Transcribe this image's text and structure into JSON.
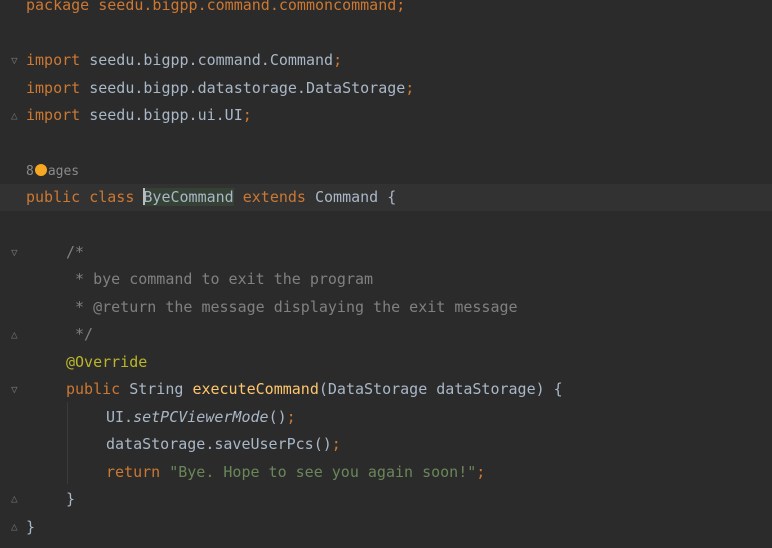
{
  "code": {
    "line_package": "package seedu.bigpp.command.commoncommand;",
    "import1_kw": "import",
    "import1_path": " seedu.bigpp.command.Command",
    "import2_kw": "import",
    "import2_path": " seedu.bigpp.datastorage.DataStorage",
    "import3_kw": "import",
    "import3_path": " seedu.bigpp.ui.UI",
    "semicolon": ";",
    "usages_prefix": "8",
    "usages_suffix": "ages",
    "class_kw": "public class ",
    "class_name": "ByeCommand",
    "extends_kw": " extends ",
    "extends_rest": "Command {",
    "cmt1": "/*",
    "cmt2": " * bye command to exit the program",
    "cmt3": " * @return the message displaying the exit message",
    "cmt4": " */",
    "annotation": "@Override",
    "method_kw": "public",
    "method_type": " String ",
    "method_name": "executeCommand",
    "method_params": "(DataStorage dataStorage) {",
    "call1_obj": "UI.",
    "call1_method": "setPCViewerMode",
    "call1_end": "()",
    "call2": "dataStorage.saveUserPcs()",
    "return_kw": "return ",
    "return_str": "\"Bye. Hope to see you again soon!\"",
    "close_method": "}",
    "close_class": "}"
  },
  "gutter_icons": [
    "fold-icon",
    "fold-icon",
    "fold-icon",
    "fold-icon",
    "fold-icon",
    "fold-icon",
    "fold-icon"
  ]
}
